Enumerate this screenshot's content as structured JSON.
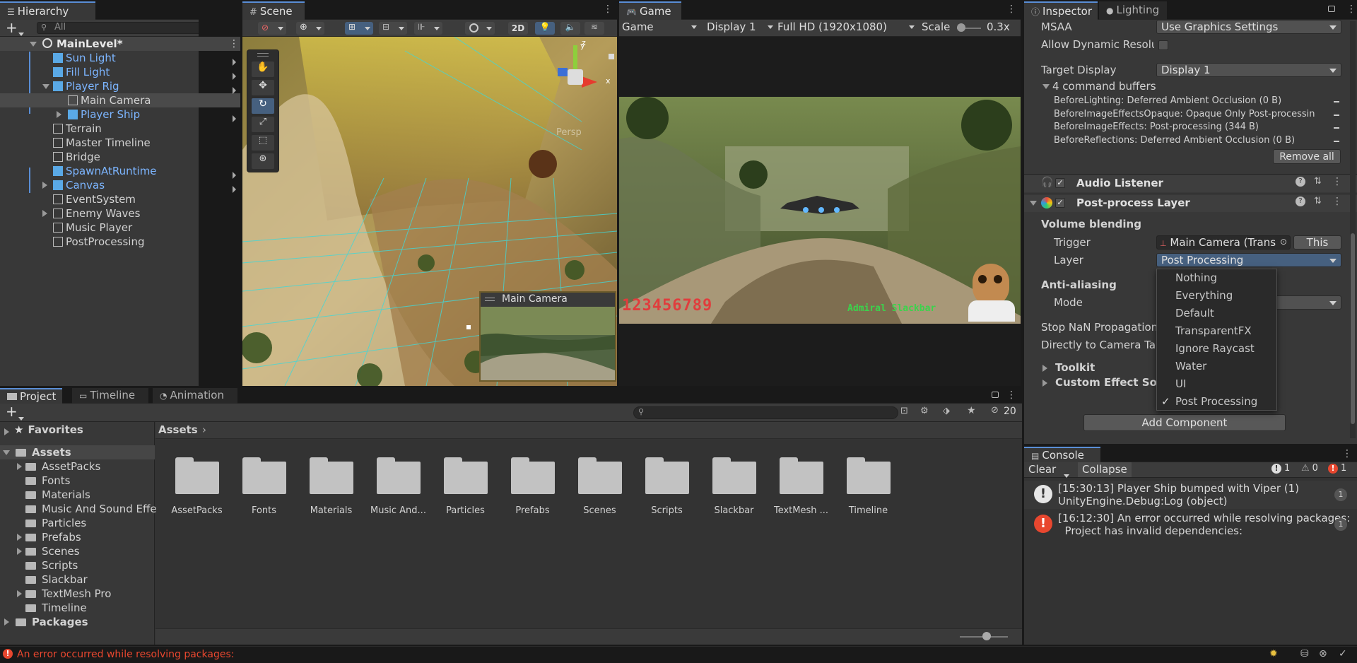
{
  "hierarchy": {
    "tab": "Hierarchy",
    "search_placeholder": "All",
    "items": [
      {
        "label": "MainLevel*"
      },
      {
        "label": "Sun Light"
      },
      {
        "label": "Fill Light"
      },
      {
        "label": "Player Rig"
      },
      {
        "label": "Main Camera"
      },
      {
        "label": "Player Ship"
      },
      {
        "label": "Terrain"
      },
      {
        "label": "Master Timeline"
      },
      {
        "label": "Bridge"
      },
      {
        "label": "SpawnAtRuntime"
      },
      {
        "label": "Canvas"
      },
      {
        "label": "EventSystem"
      },
      {
        "label": "Enemy Waves"
      },
      {
        "label": "Music Player"
      },
      {
        "label": "PostProcessing"
      }
    ]
  },
  "scene": {
    "tab": "Scene",
    "btn_2d": "2D",
    "camera_preview_title": "Main Camera",
    "persp_label": "Persp",
    "axis_x": "x",
    "axis_y": "y",
    "axis_z": "z"
  },
  "game": {
    "tab": "Game",
    "display_mode": "Game",
    "display": "Display 1",
    "resolution": "Full HD (1920x1080)",
    "scale_label": "Scale",
    "scale_value": "0.3x",
    "score": "123456789",
    "character_name": "Admiral Slackbar"
  },
  "inspector": {
    "tabs": [
      "Inspector",
      "Lighting"
    ],
    "msaa_label": "MSAA",
    "msaa_value": "Use Graphics Settings",
    "dyn_res_label": "Allow Dynamic Resolu",
    "target_display_label": "Target Display",
    "target_display_value": "Display 1",
    "command_buffers_title": "4 command buffers",
    "command_buffers": [
      "BeforeLighting: Deferred Ambient Occlusion (0 B)",
      "BeforeImageEffectsOpaque: Opaque Only Post-processing (",
      "BeforeImageEffects: Post-processing (344 B)",
      "BeforeReflections: Deferred Ambient Occlusion (0 B)"
    ],
    "remove_all": "Remove all",
    "audio_listener": "Audio Listener",
    "post_process_layer": "Post-process Layer",
    "volume_blending": "Volume blending",
    "trigger_label": "Trigger",
    "trigger_value": "Main Camera (Trans",
    "this_btn": "This",
    "layer_label": "Layer",
    "layer_value": "Post Processing",
    "anti_aliasing": "Anti-aliasing",
    "mode_label": "Mode",
    "stop_nan": "Stop NaN Propagation",
    "directly_to_camera": "Directly to Camera Tar",
    "toolkit": "Toolkit",
    "custom_effect_sort": "Custom Effect Sort",
    "add_component": "Add Component",
    "layer_menu": {
      "options": [
        "Nothing",
        "Everything",
        "Default",
        "TransparentFX",
        "Ignore Raycast",
        "Water",
        "UI",
        "Post Processing"
      ],
      "checked": "Post Processing"
    }
  },
  "project": {
    "tabs": [
      "Project",
      "Timeline",
      "Animation"
    ],
    "favorites": "Favorites",
    "assets": "Assets",
    "packages": "Packages",
    "tree": [
      "AssetPacks",
      "Fonts",
      "Materials",
      "Music And Sound Effe",
      "Particles",
      "Prefabs",
      "Scenes",
      "Scripts",
      "Slackbar",
      "TextMesh Pro",
      "Timeline"
    ],
    "breadcrumb": "Assets",
    "folders": [
      "AssetPacks",
      "Fonts",
      "Materials",
      "Music And...",
      "Particles",
      "Prefabs",
      "Scenes",
      "Scripts",
      "Slackbar",
      "TextMesh ...",
      "Timeline"
    ],
    "hidden_count": "20"
  },
  "console": {
    "tab": "Console",
    "clear": "Clear",
    "collapse": "Collapse",
    "info_count": "1",
    "warn_count": "0",
    "error_count": "1",
    "messages": [
      {
        "line1": "[15:30:13] Player Ship bumped with Viper (1)",
        "line2": "UnityEngine.Debug:Log (object)",
        "count": "1"
      },
      {
        "line1": "[16:12:30] An error occurred while resolving packages:",
        "line2": "  Project has invalid dependencies:",
        "count": "1"
      }
    ]
  },
  "status_bar": {
    "message": "An error occurred while resolving packages:"
  },
  "colors": {
    "accent": "#5a8ed6",
    "blue_text": "#7cb5ff",
    "error": "#e8472f",
    "panel": "#383838"
  }
}
